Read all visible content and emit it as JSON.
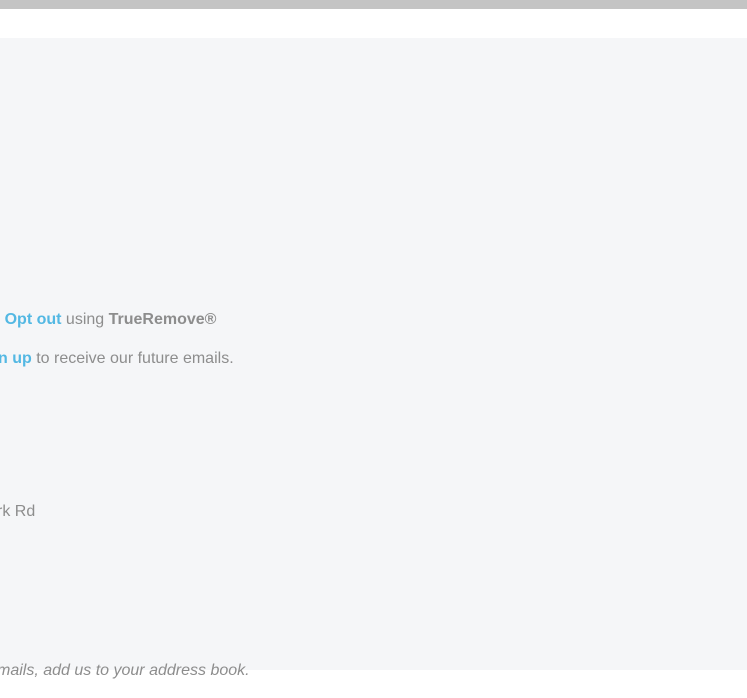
{
  "footer": {
    "optout_line": {
      "separator": "| ",
      "optout_link": "Opt out",
      "using_text": " using ",
      "brand": "TrueRemove®"
    },
    "signup_line": {
      "signup_link": "n up",
      "rest_text": " to receive our future emails."
    },
    "address_text": "rk Rd",
    "addressbook_text": "mails, add us to your address book."
  },
  "colors": {
    "top_bar": "#c4c4c4",
    "panel_background": "#f5f6f8",
    "text_gray": "#8d8d8d",
    "link_blue": "#53b8e3"
  }
}
